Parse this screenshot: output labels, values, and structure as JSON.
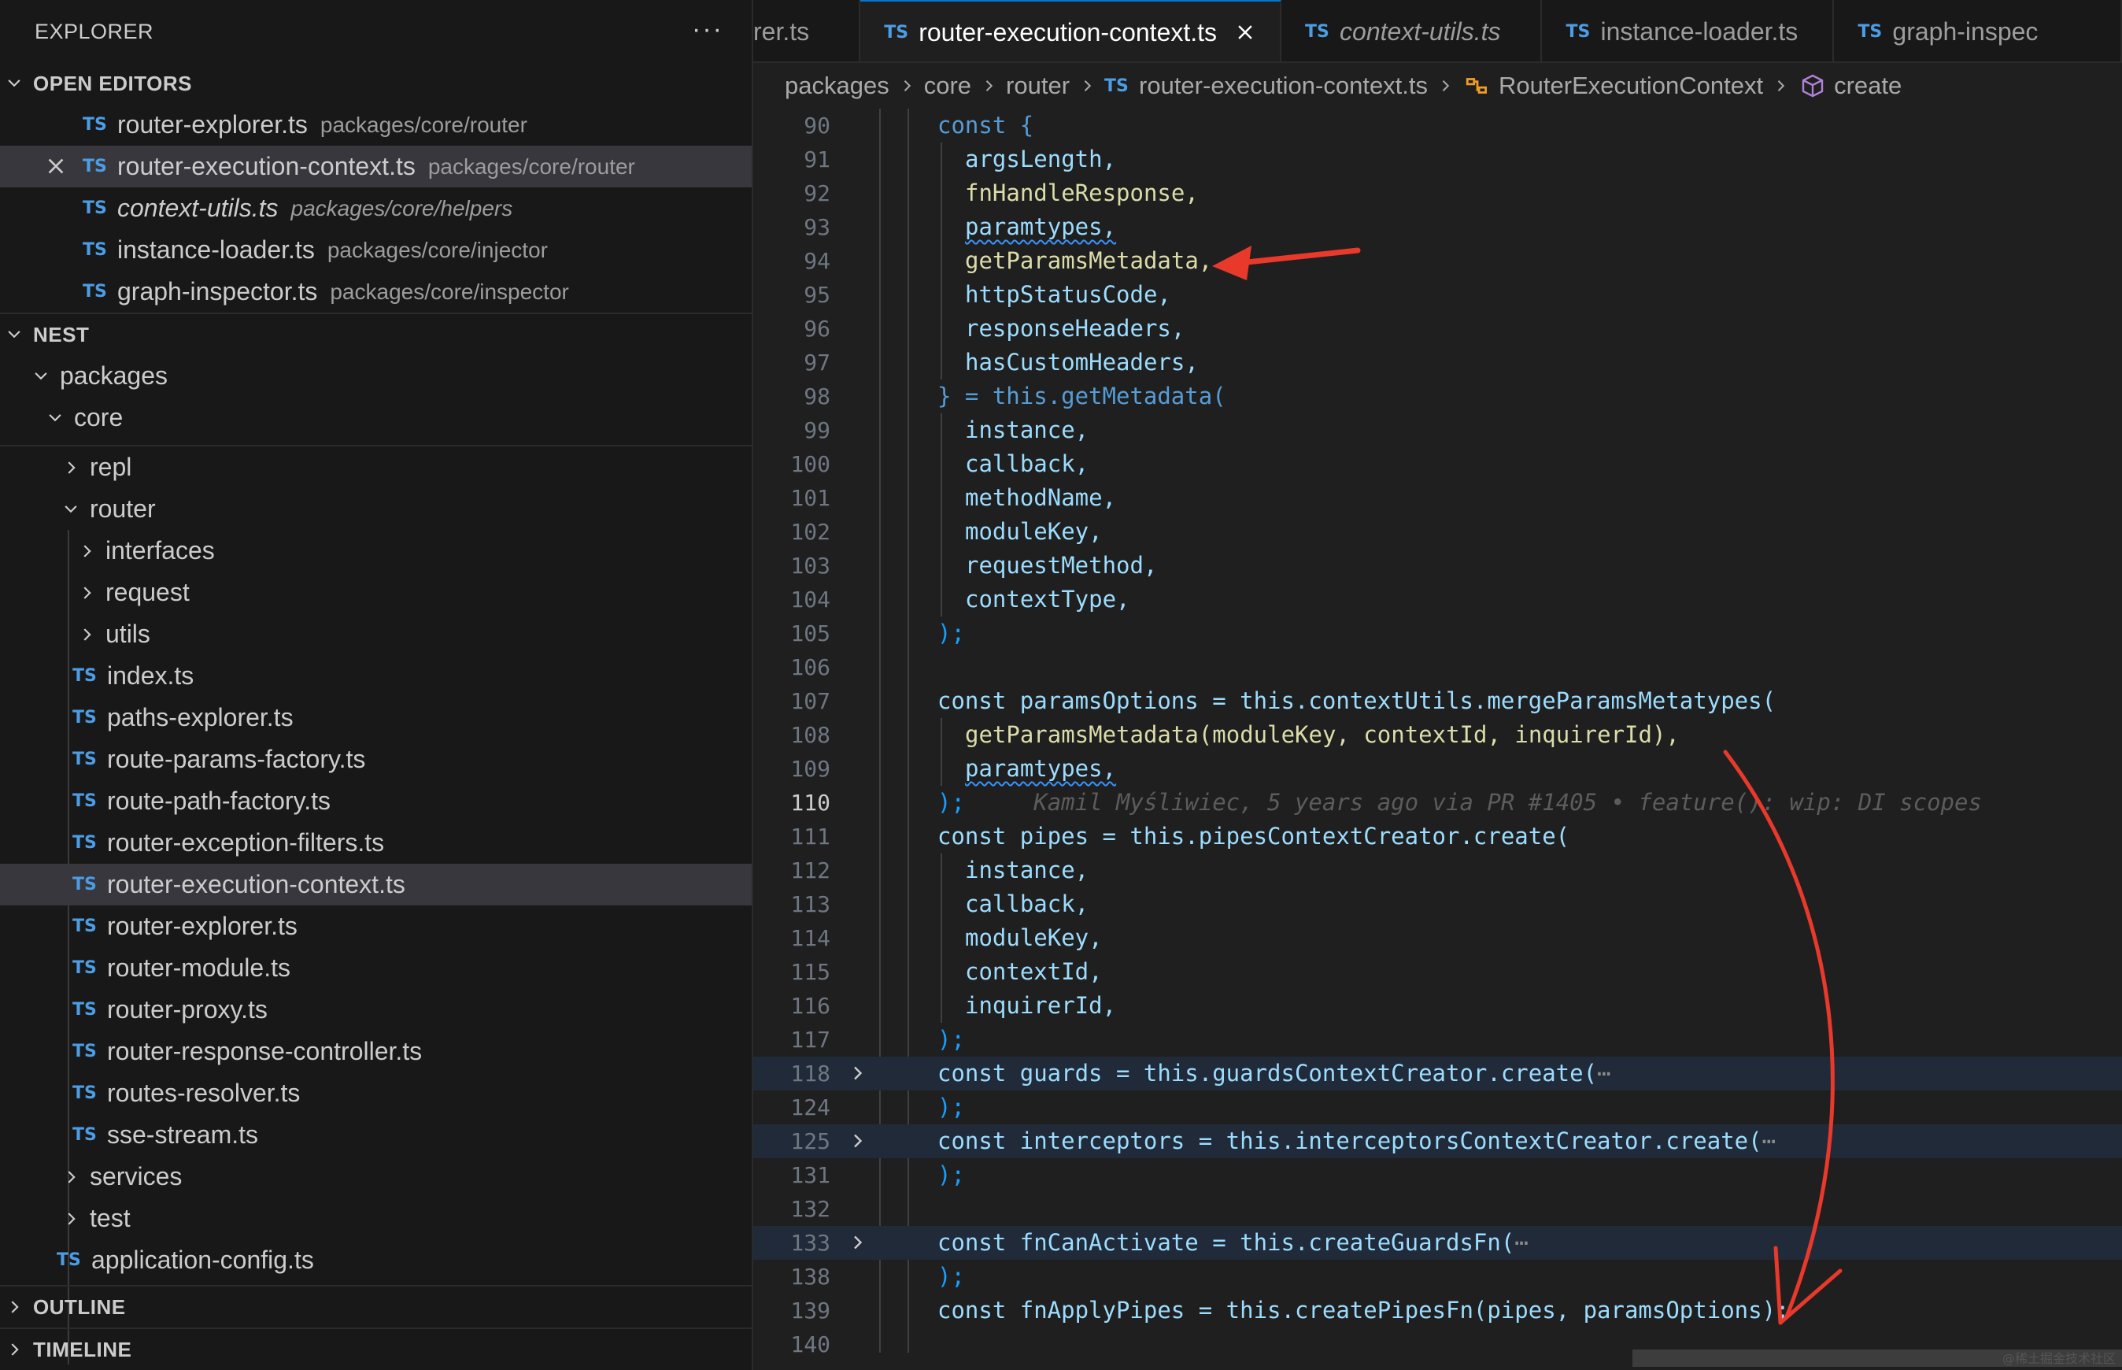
{
  "sidebar": {
    "title": "EXPLORER",
    "more": "···",
    "open_editors_label": "OPEN EDITORS",
    "open_editors": [
      {
        "name": "router-explorer.ts",
        "path": "packages/core/router",
        "italic": false,
        "active": false
      },
      {
        "name": "router-execution-context.ts",
        "path": "packages/core/router",
        "italic": false,
        "active": true
      },
      {
        "name": "context-utils.ts",
        "path": "packages/core/helpers",
        "italic": true,
        "active": false
      },
      {
        "name": "instance-loader.ts",
        "path": "packages/core/injector",
        "italic": false,
        "active": false
      },
      {
        "name": "graph-inspector.ts",
        "path": "packages/core/inspector",
        "italic": false,
        "active": false
      }
    ],
    "project_label": "NEST",
    "tree": {
      "packages": "packages",
      "core": "core",
      "repl": "repl",
      "router": "router",
      "router_children_folders": [
        "interfaces",
        "request",
        "utils"
      ],
      "router_files": [
        "index.ts",
        "paths-explorer.ts",
        "route-params-factory.ts",
        "route-path-factory.ts",
        "router-exception-filters.ts",
        "router-execution-context.ts",
        "router-explorer.ts",
        "router-module.ts",
        "router-proxy.ts",
        "router-response-controller.ts",
        "routes-resolver.ts",
        "sse-stream.ts"
      ],
      "services": "services",
      "test": "test",
      "application_config": "application-config.ts"
    },
    "outline_label": "OUTLINE",
    "timeline_label": "TIMELINE",
    "ts_badge": "TS"
  },
  "tabs": [
    {
      "name": "rer.ts",
      "italic": false,
      "active": false
    },
    {
      "name": "router-execution-context.ts",
      "italic": false,
      "active": true
    },
    {
      "name": "context-utils.ts",
      "italic": true,
      "active": false
    },
    {
      "name": "instance-loader.ts",
      "italic": false,
      "active": false
    },
    {
      "name": "graph-inspec",
      "italic": false,
      "active": false
    }
  ],
  "breadcrumb": {
    "parts": [
      "packages",
      "core",
      "router"
    ],
    "file": "router-execution-context.ts",
    "class": "RouterExecutionContext",
    "method": "create"
  },
  "editor": {
    "lines": [
      {
        "n": "90",
        "code": "const {"
      },
      {
        "n": "91",
        "code": "argsLength,"
      },
      {
        "n": "92",
        "code": "fnHandleResponse,"
      },
      {
        "n": "93",
        "code": "paramtypes,"
      },
      {
        "n": "94",
        "code": "getParamsMetadata,"
      },
      {
        "n": "95",
        "code": "httpStatusCode,"
      },
      {
        "n": "96",
        "code": "responseHeaders,"
      },
      {
        "n": "97",
        "code": "hasCustomHeaders,"
      },
      {
        "n": "98",
        "code": "} = this.getMetadata("
      },
      {
        "n": "99",
        "code": "instance,"
      },
      {
        "n": "100",
        "code": "callback,"
      },
      {
        "n": "101",
        "code": "methodName,"
      },
      {
        "n": "102",
        "code": "moduleKey,"
      },
      {
        "n": "103",
        "code": "requestMethod,"
      },
      {
        "n": "104",
        "code": "contextType,"
      },
      {
        "n": "105",
        "code": ");"
      },
      {
        "n": "106",
        "code": ""
      },
      {
        "n": "107",
        "code": "const paramsOptions = this.contextUtils.mergeParamsMetatypes("
      },
      {
        "n": "108",
        "code": "getParamsMetadata(moduleKey, contextId, inquirerId),"
      },
      {
        "n": "109",
        "code": "paramtypes,"
      },
      {
        "n": "110",
        "code": ");"
      },
      {
        "n": "111",
        "code": "const pipes = this.pipesContextCreator.create("
      },
      {
        "n": "112",
        "code": "instance,"
      },
      {
        "n": "113",
        "code": "callback,"
      },
      {
        "n": "114",
        "code": "moduleKey,"
      },
      {
        "n": "115",
        "code": "contextId,"
      },
      {
        "n": "116",
        "code": "inquirerId,"
      },
      {
        "n": "117",
        "code": ");"
      },
      {
        "n": "118",
        "code": "const guards = this.guardsContextCreator.create("
      },
      {
        "n": "124",
        "code": ");"
      },
      {
        "n": "125",
        "code": "const interceptors = this.interceptorsContextCreator.create("
      },
      {
        "n": "131",
        "code": ");"
      },
      {
        "n": "132",
        "code": ""
      },
      {
        "n": "133",
        "code": "const fnCanActivate = this.createGuardsFn("
      },
      {
        "n": "138",
        "code": ");"
      },
      {
        "n": "139",
        "code": "const fnApplyPipes = this.createPipesFn(pipes, paramsOptions);"
      },
      {
        "n": "140",
        "code": ""
      }
    ],
    "ellipsis": "⋯",
    "blame": "Kamil Myśliwiec, 5 years ago via PR #1405 • feature(): wip: DI scopes"
  },
  "colors": {
    "annotation_arrow": "#e8392b",
    "accent": "#0078d4",
    "ts_badge": "#4c9de5"
  },
  "watermark": "@稀土掘金技术社区"
}
